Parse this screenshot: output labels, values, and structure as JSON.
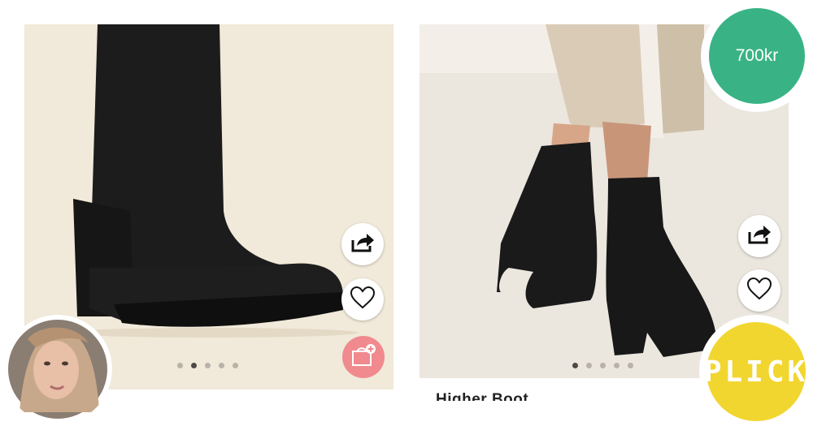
{
  "products": [
    {
      "image_icon": "knee-high-sock-boot-photo",
      "carousel": {
        "count": 5,
        "active": 2
      }
    },
    {
      "image_icon": "ankle-sock-boot-photo",
      "carousel": {
        "count": 5,
        "active": 1
      },
      "title": "Higher Boot"
    }
  ],
  "price_badge": {
    "text": "700kr",
    "color": "#39b385"
  },
  "plick_button": {
    "label": "PLICK",
    "color": "#f2d630"
  },
  "actions": {
    "share_icon": "share-icon",
    "like_icon": "heart-icon",
    "bag_icon": "add-to-bag-icon",
    "bag_color": "#f08a8e"
  },
  "seller": {
    "avatar_icon": "seller-avatar"
  }
}
